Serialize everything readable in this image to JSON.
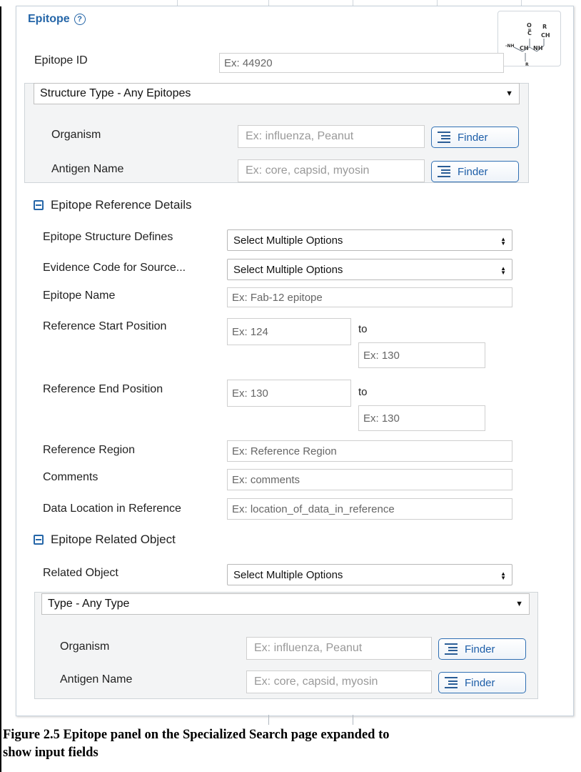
{
  "panel": {
    "title": "Epitope",
    "help_icon": "question-circle-icon",
    "molecule_icon": "peptide-structure-icon"
  },
  "epitope_id": {
    "label": "Epitope ID",
    "placeholder": "Ex: 44920"
  },
  "structure_type": {
    "selected": "Structure Type - Any Epitopes"
  },
  "structure_sub": {
    "organism": {
      "label": "Organism",
      "placeholder": "Ex: influenza, Peanut",
      "finder": "Finder"
    },
    "antigen": {
      "label": "Antigen Name",
      "placeholder": "Ex: core, capsid, myosin",
      "finder": "Finder"
    }
  },
  "reference_details": {
    "heading": "Epitope Reference Details",
    "structure_defines": {
      "label": "Epitope Structure Defines",
      "selected": "Select Multiple Options"
    },
    "evidence_code": {
      "label": "Evidence Code for Source...",
      "selected": "Select Multiple Options"
    },
    "epitope_name": {
      "label": "Epitope Name",
      "placeholder": "Ex: Fab-12 epitope"
    },
    "start_position": {
      "label": "Reference Start Position",
      "from": "Ex: 124",
      "to_label": "to",
      "to": "Ex: 130"
    },
    "end_position": {
      "label": "Reference End Position",
      "from": "Ex: 130",
      "to_label": "to",
      "to": "Ex: 130"
    },
    "region": {
      "label": "Reference Region",
      "placeholder": "Ex: Reference Region"
    },
    "comments": {
      "label": "Comments",
      "placeholder": "Ex: comments"
    },
    "data_location": {
      "label": "Data Location in Reference",
      "placeholder": "Ex: location_of_data_in_reference"
    }
  },
  "related_object": {
    "heading": "Epitope Related Object",
    "related": {
      "label": "Related Object",
      "selected": "Select Multiple Options"
    },
    "type": {
      "selected": "Type - Any Type"
    },
    "organism": {
      "label": "Organism",
      "placeholder": "Ex: influenza, Peanut",
      "finder": "Finder"
    },
    "antigen": {
      "label": "Antigen Name",
      "placeholder": "Ex: core, capsid, myosin",
      "finder": "Finder"
    }
  },
  "caption": {
    "line1": "Figure 2.5  Epitope panel on the Specialized Search page expanded to",
    "line2": "show input fields"
  },
  "colors": {
    "accent": "#2566a8",
    "border": "#cfcfcf"
  }
}
